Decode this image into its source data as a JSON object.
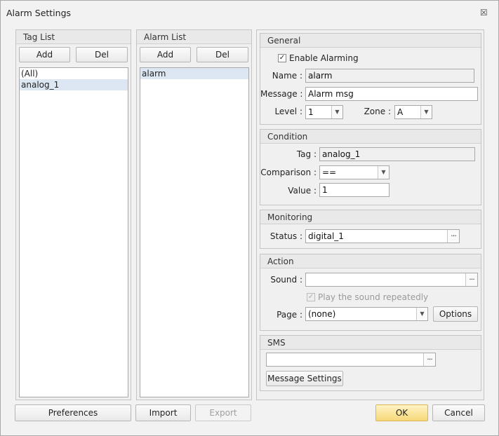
{
  "window": {
    "title": "Alarm Settings",
    "close_glyph": "☒"
  },
  "tag_list": {
    "header": "Tag List",
    "add_label": "Add",
    "del_label": "Del",
    "items": [
      "(All)",
      "analog_1"
    ],
    "selected_index": 1
  },
  "alarm_list": {
    "header": "Alarm List",
    "add_label": "Add",
    "del_label": "Del",
    "items": [
      "alarm"
    ],
    "selected_index": 0
  },
  "general": {
    "header": "General",
    "enable_label": "Enable Alarming",
    "enable_checked": true,
    "name_label": "Name :",
    "name_value": "alarm",
    "message_label": "Message :",
    "message_value": "Alarm msg",
    "level_label": "Level :",
    "level_value": "1",
    "zone_label": "Zone :",
    "zone_value": "A"
  },
  "condition": {
    "header": "Condition",
    "tag_label": "Tag :",
    "tag_value": "analog_1",
    "comparison_label": "Comparison :",
    "comparison_value": "==",
    "value_label": "Value :",
    "value_value": "1"
  },
  "monitoring": {
    "header": "Monitoring",
    "status_label": "Status :",
    "status_value": "digital_1"
  },
  "action": {
    "header": "Action",
    "sound_label": "Sound :",
    "sound_value": "",
    "repeat_label": "Play the sound repeatedly",
    "repeat_checked": true,
    "page_label": "Page :",
    "page_value": "(none)",
    "options_label": "Options"
  },
  "sms": {
    "header": "SMS",
    "value": "",
    "message_settings_label": "Message Settings"
  },
  "footer": {
    "preferences_label": "Preferences",
    "import_label": "Import",
    "export_label": "Export",
    "ok_label": "OK",
    "cancel_label": "Cancel"
  },
  "icons": {
    "dropdown": "chevron-down-icon",
    "browse": "ellipsis-icon",
    "close": "close-icon",
    "check": "checkmark-icon"
  },
  "colors": {
    "selected_row": "#dde7f3",
    "ok_button": "#f7d878"
  }
}
